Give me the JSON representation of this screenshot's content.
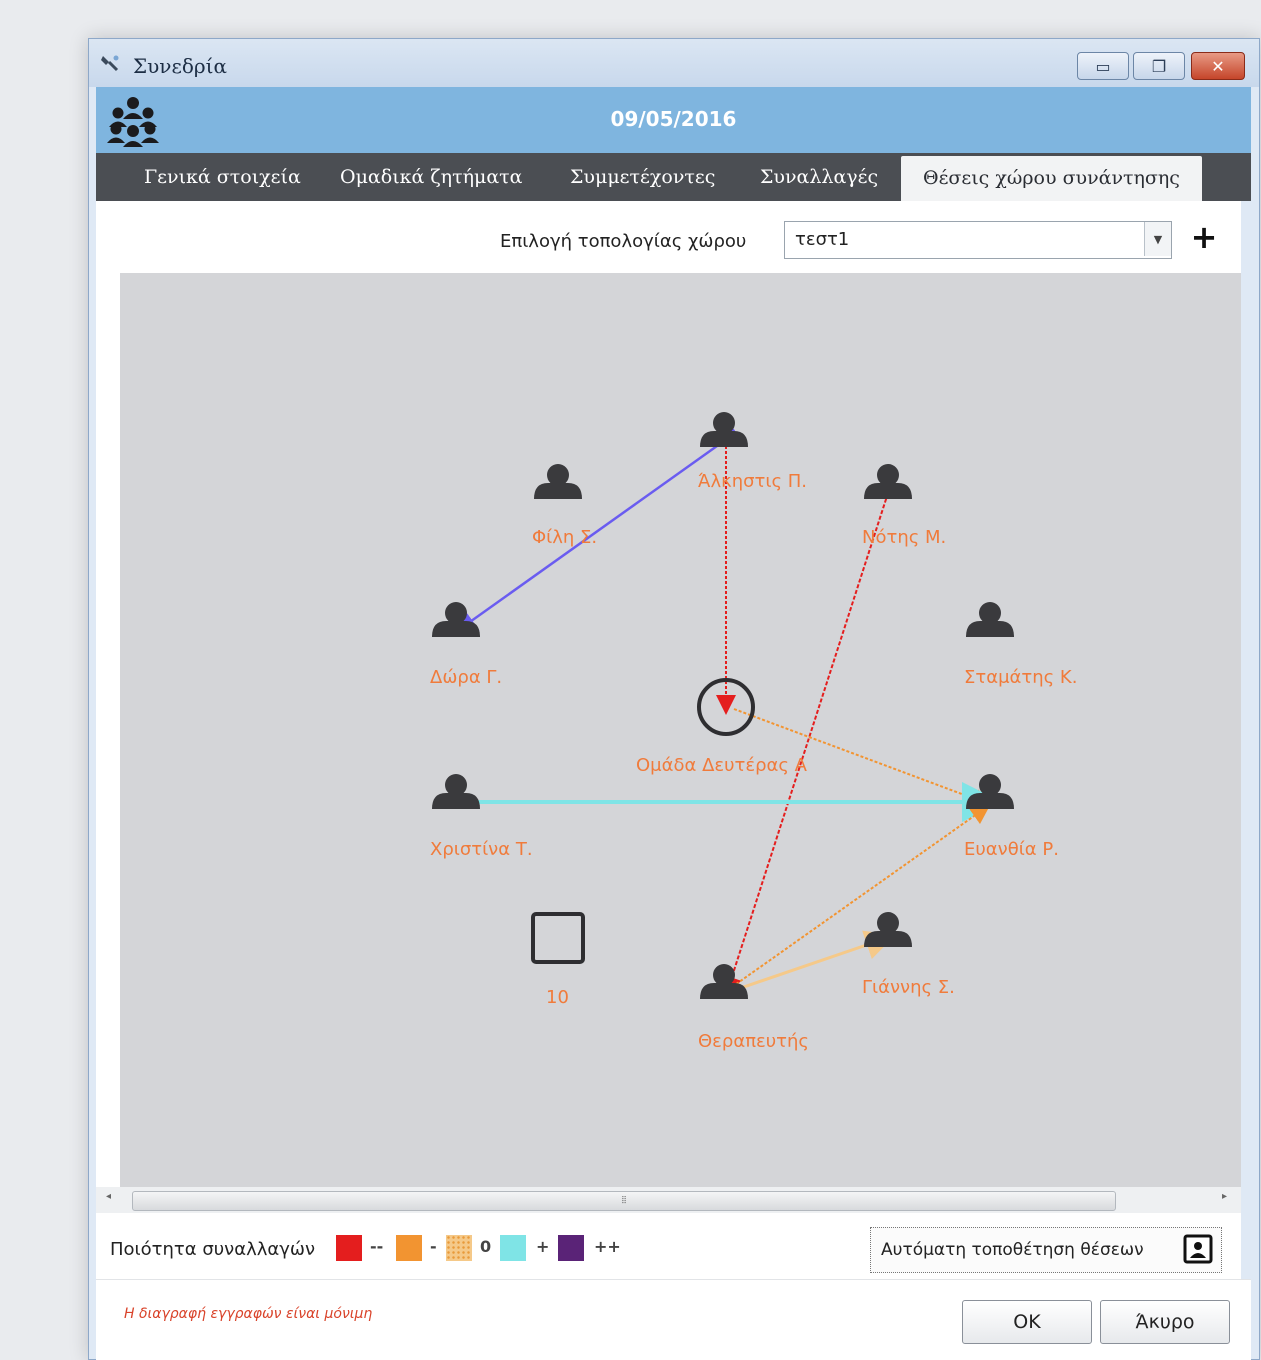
{
  "window": {
    "title": "Συνεδρία",
    "minimize_glyph": "▭",
    "restore_glyph": "❐",
    "close_glyph": "✕"
  },
  "header": {
    "icon": "group-icon",
    "date": "09/05/2016"
  },
  "tabs": [
    {
      "label": "Γενικά στοιχεία",
      "active": false
    },
    {
      "label": "Ομαδικά ζητήματα",
      "active": false
    },
    {
      "label": "Συμμετέχοντες",
      "active": false
    },
    {
      "label": "Συναλλαγές",
      "active": false
    },
    {
      "label": "Θέσεις χώρου συνάντησης",
      "active": true
    }
  ],
  "topology": {
    "label": "Επιλογή τοπολογίας χώρου",
    "selected": "τεστ1",
    "add_label": "+"
  },
  "participants": [
    {
      "id": "alkistis",
      "label": "Άλκηστις Π."
    },
    {
      "id": "fili",
      "label": "Φίλη Σ."
    },
    {
      "id": "notis",
      "label": "Νότης Μ."
    },
    {
      "id": "dora",
      "label": "Δώρα Γ."
    },
    {
      "id": "stamatis",
      "label": "Σταμάτης Κ."
    },
    {
      "id": "christina",
      "label": "Χριστίνα Τ."
    },
    {
      "id": "efthymia",
      "label": "Ευανθία Ρ."
    },
    {
      "id": "giannis",
      "label": "Γιάννης Σ."
    },
    {
      "id": "therapist",
      "label": "Θεραπευτής"
    }
  ],
  "group_node": {
    "label": "Ομάδα Δευτέρας Α"
  },
  "object_node": {
    "label": "10"
  },
  "connections": [
    {
      "from": "alkistis",
      "to": "dora",
      "quality": "++"
    },
    {
      "from": "alkistis",
      "to": "group",
      "quality": "--"
    },
    {
      "from": "notis",
      "to": "therapist",
      "quality": "--"
    },
    {
      "from": "group",
      "to": "efthymia",
      "quality": "-"
    },
    {
      "from": "christina",
      "to": "efthymia",
      "quality": "+"
    },
    {
      "from": "therapist",
      "to": "efthymia",
      "quality": "-"
    },
    {
      "from": "therapist",
      "to": "giannis",
      "quality": "0"
    }
  ],
  "legend": {
    "label": "Ποιότητα συναλλαγών",
    "items": [
      {
        "color": "#e41e1e",
        "symbol": "--"
      },
      {
        "color": "#f29431",
        "symbol": "-"
      },
      {
        "color": "#f5c989",
        "symbol": "0"
      },
      {
        "color": "#7fe4e6",
        "symbol": "+"
      },
      {
        "color": "#5a2377",
        "symbol": "++"
      }
    ]
  },
  "auto_place": {
    "label": "Αυτόματη τοποθέτηση θέσεων",
    "icon": "person-card-icon"
  },
  "footer": {
    "note": "Η διαγραφή εγγραφών είναι μόνιμη",
    "ok": "OK",
    "cancel": "Άκυρο"
  },
  "colors": {
    "label_orange": "#f07b3b",
    "header_blue": "#7fb5df",
    "tabbar_dark": "#4b4e53",
    "canvas_gray": "#d4d5d8",
    "node_dark": "#3a3a3d"
  }
}
